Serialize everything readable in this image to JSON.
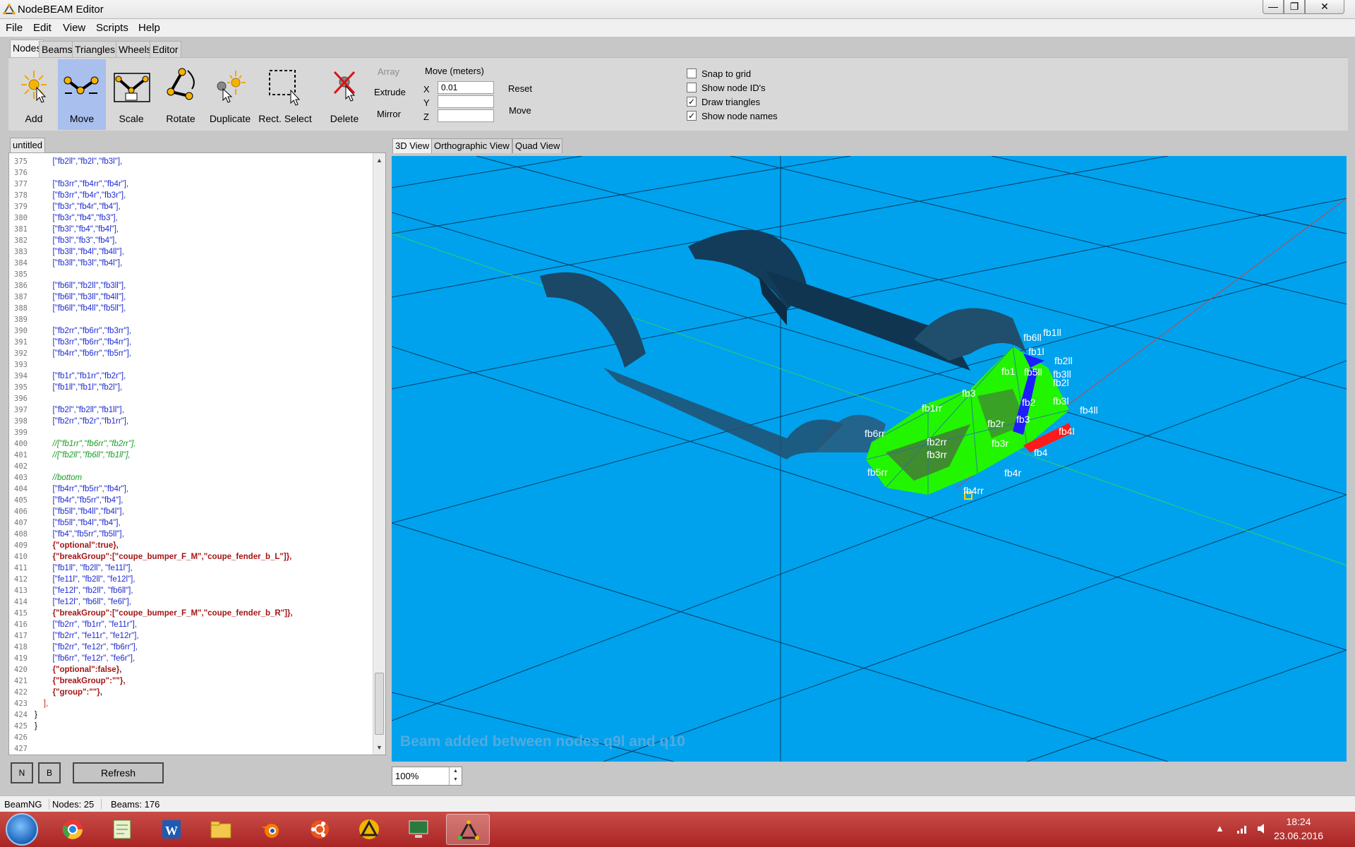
{
  "window": {
    "title": "NodeBEAM Editor",
    "min_glyph": "—",
    "max_glyph": "❐",
    "close_glyph": "✕"
  },
  "menu": [
    "File",
    "Edit",
    "View",
    "Scripts",
    "Help"
  ],
  "tool_tabs": [
    "Nodes",
    "Beams",
    "Triangles",
    "Wheels",
    "Editor"
  ],
  "tools": [
    {
      "label": "Add",
      "icon": "add-node-icon"
    },
    {
      "label": "Move",
      "icon": "move-node-icon",
      "active": true
    },
    {
      "label": "Scale",
      "icon": "scale-icon"
    },
    {
      "label": "Rotate",
      "icon": "rotate-icon"
    },
    {
      "label": "Duplicate",
      "icon": "duplicate-icon"
    },
    {
      "label": "Rect. Select",
      "icon": "rect-select-icon"
    },
    {
      "label": "Delete",
      "icon": "delete-icon"
    }
  ],
  "transform": {
    "array": "Array",
    "extrude": "Extrude",
    "mirror": "Mirror",
    "move_title": "Move (meters)",
    "x_label": "X",
    "y_label": "Y",
    "z_label": "Z",
    "x_value": "0.01",
    "y_value": "",
    "z_value": "",
    "reset": "Reset",
    "move": "Move"
  },
  "options": [
    {
      "label": "Snap to grid",
      "checked": false
    },
    {
      "label": "Show node ID's",
      "checked": false
    },
    {
      "label": "Draw triangles",
      "checked": true
    },
    {
      "label": "Show node names",
      "checked": true
    }
  ],
  "check_glyph": "✓",
  "editor": {
    "tab": "untitled",
    "scroll_up": "▲",
    "scroll_down": "▼",
    "lines": [
      {
        "n": "375",
        "t": "        [\"fb2ll\",\"fb2l\",\"fb3l\"],",
        "c": ""
      },
      {
        "n": "376",
        "t": "",
        "c": ""
      },
      {
        "n": "377",
        "t": "        [\"fb3rr\",\"fb4rr\",\"fb4r\"],",
        "c": ""
      },
      {
        "n": "378",
        "t": "        [\"fb3rr\",\"fb4r\",\"fb3r\"],",
        "c": ""
      },
      {
        "n": "379",
        "t": "        [\"fb3r\",\"fb4r\",\"fb4\"],",
        "c": ""
      },
      {
        "n": "380",
        "t": "        [\"fb3r\",\"fb4\",\"fb3\"],",
        "c": ""
      },
      {
        "n": "381",
        "t": "        [\"fb3l\",\"fb4\",\"fb4l\"],",
        "c": ""
      },
      {
        "n": "382",
        "t": "        [\"fb3l\",\"fb3\",\"fb4\"],",
        "c": ""
      },
      {
        "n": "383",
        "t": "        [\"fb3ll\",\"fb4l\",\"fb4ll\"],",
        "c": ""
      },
      {
        "n": "384",
        "t": "        [\"fb3ll\",\"fb3l\",\"fb4l\"],",
        "c": ""
      },
      {
        "n": "385",
        "t": "",
        "c": ""
      },
      {
        "n": "386",
        "t": "        [\"fb6ll\",\"fb2ll\",\"fb3ll\"],",
        "c": ""
      },
      {
        "n": "387",
        "t": "        [\"fb6ll\",\"fb3ll\",\"fb4ll\"],",
        "c": ""
      },
      {
        "n": "388",
        "t": "        [\"fb6ll\",\"fb4ll\",\"fb5ll\"],",
        "c": ""
      },
      {
        "n": "389",
        "t": "",
        "c": ""
      },
      {
        "n": "390",
        "t": "        [\"fb2rr\",\"fb6rr\",\"fb3rr\"],",
        "c": ""
      },
      {
        "n": "391",
        "t": "        [\"fb3rr\",\"fb6rr\",\"fb4rr\"],",
        "c": ""
      },
      {
        "n": "392",
        "t": "        [\"fb4rr\",\"fb6rr\",\"fb5rr\"],",
        "c": ""
      },
      {
        "n": "393",
        "t": "",
        "c": ""
      },
      {
        "n": "394",
        "t": "        [\"fb1r\",\"fb1rr\",\"fb2r\"],",
        "c": ""
      },
      {
        "n": "395",
        "t": "        [\"fb1ll\",\"fb1l\",\"fb2l\"],",
        "c": ""
      },
      {
        "n": "396",
        "t": "",
        "c": ""
      },
      {
        "n": "397",
        "t": "        [\"fb2l\",\"fb2ll\",\"fb1ll\"],",
        "c": ""
      },
      {
        "n": "398",
        "t": "        [\"fb2rr\",\"fb2r\",\"fb1rr\"],",
        "c": ""
      },
      {
        "n": "399",
        "t": "",
        "c": ""
      },
      {
        "n": "400",
        "t": "        //[\"fb1rr\",\"fb6rr\",\"fb2rr\"],",
        "c": "c-comment"
      },
      {
        "n": "401",
        "t": "        //[\"fb2ll\",\"fb6ll\",\"fb1ll\"],",
        "c": "c-comment"
      },
      {
        "n": "402",
        "t": "",
        "c": ""
      },
      {
        "n": "403",
        "t": "        //bottom",
        "c": "c-comment"
      },
      {
        "n": "404",
        "t": "        [\"fb4rr\",\"fb5rr\",\"fb4r\"],",
        "c": ""
      },
      {
        "n": "405",
        "t": "        [\"fb4r\",\"fb5rr\",\"fb4\"],",
        "c": ""
      },
      {
        "n": "406",
        "t": "        [\"fb5ll\",\"fb4ll\",\"fb4l\"],",
        "c": ""
      },
      {
        "n": "407",
        "t": "        [\"fb5ll\",\"fb4l\",\"fb4\"],",
        "c": ""
      },
      {
        "n": "408",
        "t": "        [\"fb4\",\"fb5rr\",\"fb5ll\"],",
        "c": ""
      },
      {
        "n": "409",
        "t": "        {\"optional\":true},",
        "c": "c-key"
      },
      {
        "n": "410",
        "t": "        {\"breakGroup\":[\"coupe_bumper_F_M\",\"coupe_fender_b_L\"]},",
        "c": "c-key"
      },
      {
        "n": "411",
        "t": "        [\"fb1ll\", \"fb2ll\", \"fe11l\"],",
        "c": ""
      },
      {
        "n": "412",
        "t": "        [\"fe11l\", \"fb2ll\", \"fe12l\"],",
        "c": ""
      },
      {
        "n": "413",
        "t": "        [\"fe12l\", \"fb2ll\", \"fb6ll\"],",
        "c": ""
      },
      {
        "n": "414",
        "t": "        [\"fe12l\", \"fb6ll\", \"fe6l\"],",
        "c": ""
      },
      {
        "n": "415",
        "t": "        {\"breakGroup\":[\"coupe_bumper_F_M\",\"coupe_fender_b_R\"]},",
        "c": "c-key"
      },
      {
        "n": "416",
        "t": "        [\"fb2rr\", \"fb1rr\", \"fe11r\"],",
        "c": ""
      },
      {
        "n": "417",
        "t": "        [\"fb2rr\", \"fe11r\", \"fe12r\"],",
        "c": ""
      },
      {
        "n": "418",
        "t": "        [\"fb2rr\", \"fe12r\", \"fb6rr\"],",
        "c": ""
      },
      {
        "n": "419",
        "t": "        [\"fb6rr\", \"fe12r\", \"fe6r\"],",
        "c": ""
      },
      {
        "n": "420",
        "t": "        {\"optional\":false},",
        "c": "c-key"
      },
      {
        "n": "421",
        "t": "        {\"breakGroup\":\"\"},",
        "c": "c-key"
      },
      {
        "n": "422",
        "t": "        {\"group\":\"\"},",
        "c": "c-key"
      },
      {
        "n": "423",
        "t": "    ],",
        "c": "c-red"
      },
      {
        "n": "424",
        "t": "}",
        "c": "c-blk"
      },
      {
        "n": "425",
        "t": "}",
        "c": "c-blk"
      },
      {
        "n": "426",
        "t": "",
        "c": ""
      },
      {
        "n": "427",
        "t": "",
        "c": ""
      }
    ]
  },
  "bottom_buttons": {
    "n": "N",
    "b": "B",
    "refresh": "Refresh"
  },
  "view_tabs": [
    "3D View",
    "Orthographic View",
    "Quad View"
  ],
  "viewport": {
    "bg_color": "#00a2ee",
    "mesh_color": "#22f500",
    "message": "Beam added between nodes q9l and q10",
    "node_labels": [
      {
        "name": "fb6ll"
      },
      {
        "name": "fb1ll"
      },
      {
        "name": "fb1l"
      },
      {
        "name": "fb2ll"
      },
      {
        "name": "fb1"
      },
      {
        "name": "fb5ll"
      },
      {
        "name": "fb3ll"
      },
      {
        "name": "fb2l"
      },
      {
        "name": "fb3"
      },
      {
        "name": "fb2"
      },
      {
        "name": "fb3l"
      },
      {
        "name": "fb4ll"
      },
      {
        "name": "fb1rr"
      },
      {
        "name": "fb3"
      },
      {
        "name": "fb2r"
      },
      {
        "name": "fb4l"
      },
      {
        "name": "fb6rr"
      },
      {
        "name": "fb2rr"
      },
      {
        "name": "fb3r"
      },
      {
        "name": "fb4"
      },
      {
        "name": "fb3rr"
      },
      {
        "name": "fb5rr"
      },
      {
        "name": "fb4r"
      },
      {
        "name": "fb4rr"
      }
    ]
  },
  "zoom": {
    "value": "100%",
    "spin_up": "▲",
    "spin_down": "▼"
  },
  "status": {
    "profile": "BeamNG",
    "nodes": "Nodes: 25",
    "beams": "Beams: 176"
  },
  "taskbar": {
    "clock_time": "18:24",
    "clock_date": "23.06.2016",
    "apps": [
      "chrome-icon",
      "notepad-icon",
      "word-icon",
      "explorer-icon",
      "blender-icon",
      "ubuntu-icon",
      "app-triangle-icon",
      "remote-desktop-icon",
      "nodebeam-icon"
    ],
    "tray_glyph": "▲"
  }
}
